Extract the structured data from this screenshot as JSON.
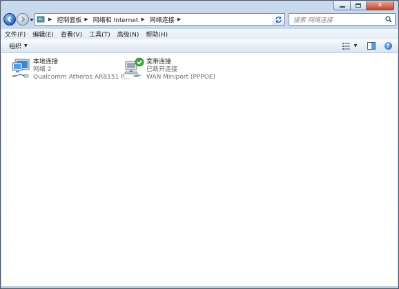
{
  "breadcrumbs": [
    "控制面板",
    "网络和 Internet",
    "网络连接"
  ],
  "search": {
    "placeholder": "搜索 网络连接"
  },
  "menu": [
    "文件(F)",
    "编辑(E)",
    "查看(V)",
    "工具(T)",
    "高级(N)",
    "帮助(H)"
  ],
  "commandbar": {
    "organize_label": "组织"
  },
  "connections": [
    {
      "name": "本地连接",
      "status": "网络  2",
      "device": "Qualcomm Atheros AR8151 P...",
      "icon": "lan-adapter-icon"
    },
    {
      "name": "宽带连接",
      "status": "已断开连接",
      "device": "WAN Miniport (PPPOE)",
      "icon": "broadband-adapter-icon"
    }
  ],
  "colors": {
    "close": "#c6452c",
    "accent": "#2465b7",
    "check": "#3ea83a"
  }
}
